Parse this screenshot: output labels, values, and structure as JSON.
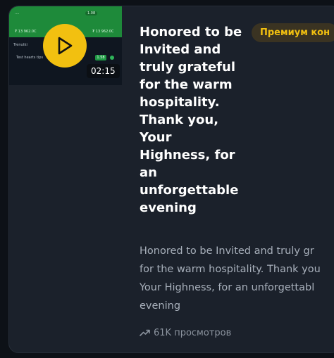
{
  "card": {
    "title": "Honored to be Invited and truly grateful for the warm hospitality. Thank you, Your Highness, for an unforgettable evening",
    "badge": "Премиум кон",
    "description": "Honored to be Invited and truly gr\nfor the warm hospitality. Thank you\nYour Highness, for an unforgettabl\nevening",
    "duration": "02:15",
    "views": "61K просмотров"
  },
  "thumbnail": {
    "texts": [
      "1.08",
      "₮ 13 962.0C",
      "₮ 13 962.0C",
      "Trenutki",
      "1.58",
      "Test hearts tips"
    ]
  },
  "colors": {
    "accent": "#f2c010",
    "card_bg": "#1b212b",
    "page_bg": "#0d1117"
  },
  "icons": {
    "play": "play-icon",
    "trend": "trending-up-icon"
  }
}
